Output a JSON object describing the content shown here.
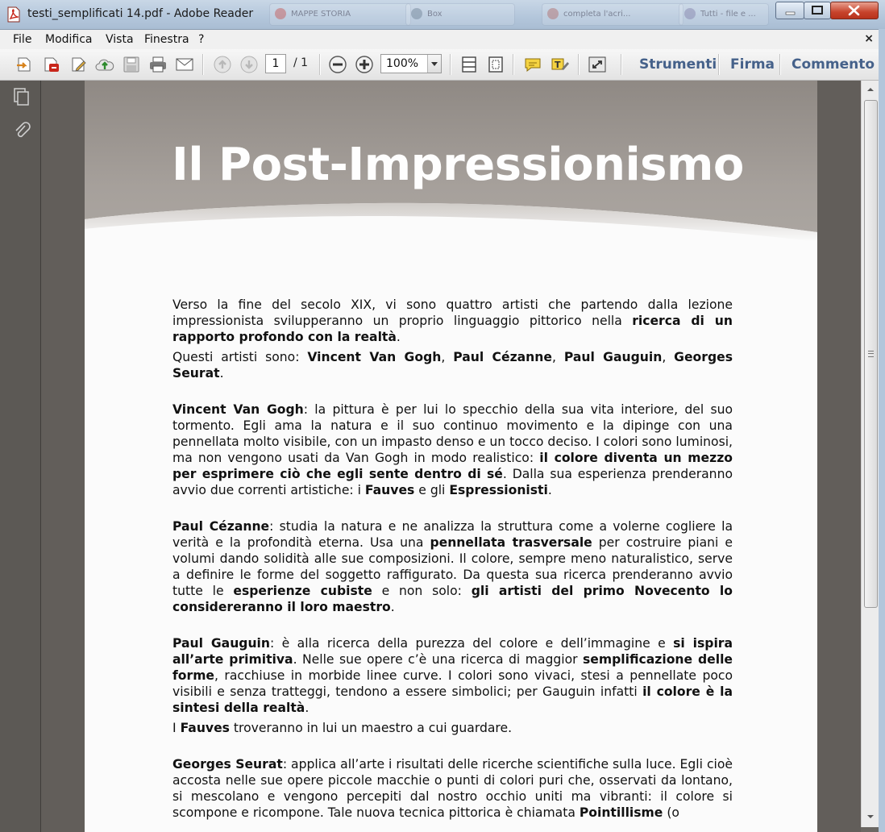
{
  "window": {
    "title": "testi_semplificati 14.pdf - Adobe Reader",
    "background_tabs": [
      "MAPPE STORIA",
      "Box",
      "completa l'acri...",
      "Tutti - file e ..."
    ]
  },
  "menu": {
    "items": [
      "File",
      "Modifica",
      "Vista",
      "Finestra",
      "?"
    ],
    "close_glyph": "×"
  },
  "toolbar": {
    "page_current": "1",
    "page_total": "/ 1",
    "zoom": "100%",
    "links": [
      "Strumenti",
      "Firma",
      "Commento"
    ],
    "accent_color": "#45618a"
  },
  "document": {
    "title": "Il Post-Impressionismo",
    "header_color": "#9f9994",
    "intro": {
      "t1": "Verso la fine del secolo XIX, vi sono quattro artisti che partendo dalla lezione impressionista svilupperanno un proprio linguaggio pittorico nella ",
      "b1": "ricerca di un rapporto profondo con la realtà",
      "t2": "."
    },
    "artists_line": {
      "t1": "Questi artisti sono: ",
      "b1": "Vincent Van Gogh",
      "t2": ", ",
      "b2": "Paul Cézanne",
      "t3": ", ",
      "b3": "Paul Gauguin",
      "t4": ", ",
      "b4": "Georges Seurat",
      "t5": "."
    },
    "van_gogh": {
      "b1": "Vincent Van Gogh",
      "t1": ": la pittura è per lui lo specchio della sua vita interiore, del suo tormento. Egli ama la natura e il suo continuo movimento e la dipinge con una pennellata molto visibile, con un impasto denso e un tocco deciso. I colori sono luminosi, ma non vengono usati da Van Gogh in modo realistico: ",
      "b2": "il colore diventa un mezzo per esprimere ciò che egli sente dentro di sé",
      "t2": ". Dalla sua esperienza prenderanno avvio due correnti artistiche: i ",
      "b3": "Fauves",
      "t3": " e gli ",
      "b4": "Espressionisti",
      "t4": "."
    },
    "cezanne": {
      "b1": "Paul Cézanne",
      "t1": ": studia la natura e ne analizza la struttura come a volerne cogliere la verità e la profondità eterna. Usa una ",
      "b2": "pennellata trasversale",
      "t2": " per costruire piani e volumi dando solidità alle sue composizioni. Il colore, sempre meno naturalistico, serve a definire le forme del soggetto raffigurato. Da questa sua ricerca prenderanno avvio tutte le ",
      "b3": "esperienze cubiste",
      "t3": " e non solo: ",
      "b4": "gli artisti del primo Novecento lo considereranno il loro maestro",
      "t4": "."
    },
    "gauguin": {
      "b1": "Paul Gauguin",
      "t1": ": è alla ricerca della purezza del colore e dell’immagine e ",
      "b2": "si ispira all’arte primitiva",
      "t2": ". Nelle sue opere c’è una ricerca di maggior ",
      "b3": "semplificazione delle forme",
      "t3": ", racchiuse in morbide linee curve. I colori sono vivaci, stesi a pennellate poco visibili e senza tratteggi, tendono a essere simbolici; per Gauguin infatti ",
      "b4": "il colore è la sintesi della realtà",
      "t4": "."
    },
    "fauves_line": {
      "t1": "I ",
      "b1": "Fauves",
      "t2": " troveranno in lui un maestro a cui guardare."
    },
    "seurat": {
      "b1": "Georges Seurat",
      "t1": ": applica all’arte i risultati delle ricerche scientifiche sulla luce. Egli cioè accosta nelle sue opere piccole macchie o punti di colori puri che, osservati da lontano, si mescolano e vengono percepiti dal nostro occhio uniti ma vibranti: il colore si scompone e ricompone. Tale nuova tecnica pittorica è chiamata ",
      "b2": "Pointillisme",
      "t2": " (o"
    }
  }
}
